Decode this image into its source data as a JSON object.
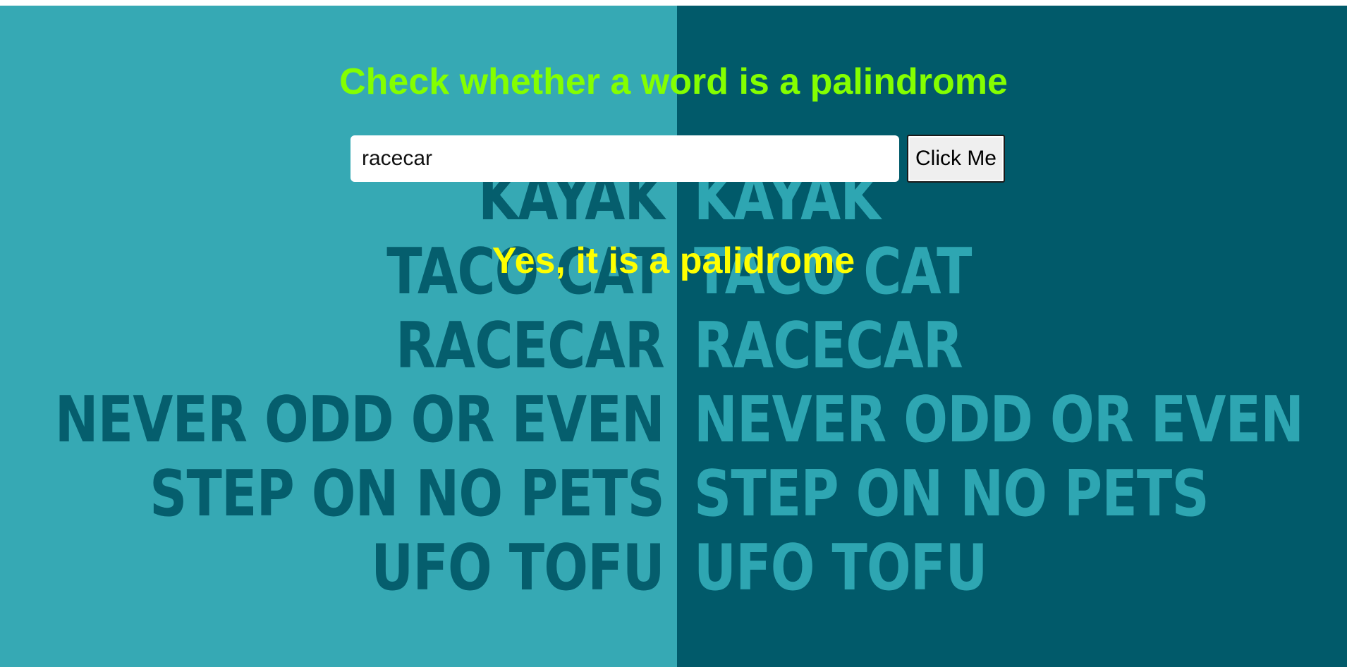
{
  "header": {
    "title": "Check whether a word is a palindrome"
  },
  "form": {
    "input_value": "racecar",
    "button_label": "Click Me"
  },
  "result": {
    "message": "Yes, it is a palidrome"
  },
  "background": {
    "words": [
      "KAYAK",
      "TACO CAT",
      "RACECAR",
      "NEVER ODD OR EVEN",
      "STEP ON NO PETS",
      "UFO TOFU"
    ],
    "colors": {
      "left_panel": "#36a9b4",
      "right_panel": "#015a6a",
      "left_text": "#055e6d",
      "right_text": "#2ea6b2"
    }
  },
  "colors": {
    "title": "#84ff00",
    "result": "#ffff00"
  }
}
